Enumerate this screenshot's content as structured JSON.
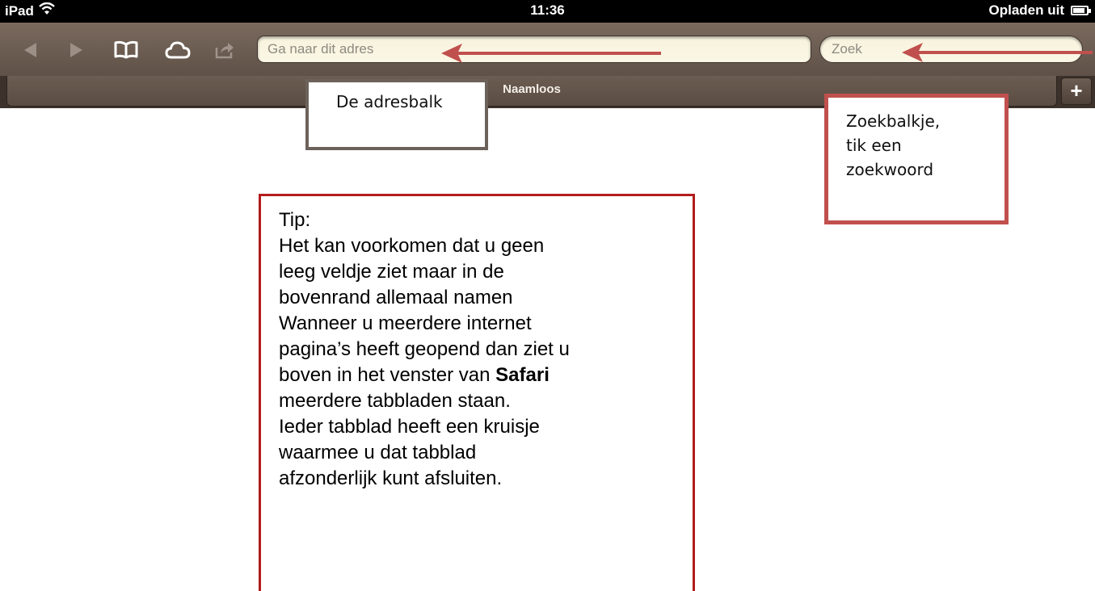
{
  "status_bar": {
    "device": "iPad",
    "time": "11:36",
    "charging": "Opladen uit",
    "battery_level": 0.9
  },
  "toolbar": {
    "back_icon": "back-arrow-icon",
    "forward_icon": "forward-arrow-icon",
    "bookmarks_icon": "open-book-icon",
    "icloud_icon": "cloud-icon",
    "share_icon": "share-arrow-icon",
    "address_placeholder": "Ga naar dit adres",
    "search_placeholder": "Zoek"
  },
  "tabs": {
    "active_label": "Naamloos",
    "new_tab_label": "+"
  },
  "annotations": {
    "address_callout": "De adresbalk",
    "search_callout": [
      "Zoekbalkje,",
      "tik een",
      "zoekwoord"
    ],
    "arrow_color": "#c0504d",
    "tip": {
      "title": "Tip:",
      "lines": [
        "Het kan voorkomen dat u geen",
        "leeg veldje ziet maar in de",
        "bovenrand allemaal namen",
        "Wanneer u meerdere internet",
        "pagina’s heeft geopend dan ziet u",
        "boven in het venster van ",
        "Safari",
        "meerdere tabbladen staan.",
        "Ieder tabblad heeft een kruisje",
        "waarmee u dat tabblad",
        "afzonderlijk kunt afsluiten."
      ]
    }
  },
  "colors": {
    "toolbar": "#6b5c51",
    "field_background": "#f8f3dd",
    "callout_search_border": "#c0504d",
    "callout_address_border": "#6d625b",
    "tip_border": "#b31b1b"
  }
}
